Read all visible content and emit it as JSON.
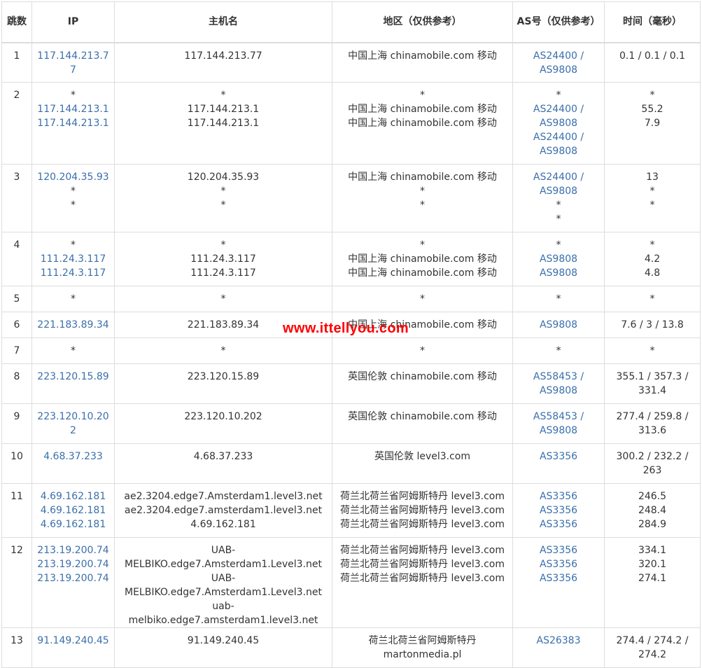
{
  "watermark": "www.ittellyou.com",
  "colors": {
    "link": "#3a6fab",
    "border": "#dddddd",
    "text": "#333333",
    "watermark": "#ff0000"
  },
  "headers": {
    "hop": "跳数",
    "ip": "IP",
    "host": "主机名",
    "region": "地区（仅供参考）",
    "as": "AS号（仅供参考）",
    "time": "时间（毫秒）"
  },
  "rows": [
    {
      "hop": "1",
      "ip": [
        "117.144.213.77"
      ],
      "host": [
        "117.144.213.77"
      ],
      "region": [
        "中国上海 chinamobile.com 移动"
      ],
      "as": [
        "AS24400 /",
        "AS9808"
      ],
      "time": [
        "0.1 / 0.1 / 0.1"
      ]
    },
    {
      "hop": "2",
      "ip": [
        "*",
        "117.144.213.1",
        "117.144.213.1"
      ],
      "host": [
        "*",
        "117.144.213.1",
        "117.144.213.1"
      ],
      "region": [
        "*",
        "中国上海 chinamobile.com 移动",
        "中国上海 chinamobile.com 移动"
      ],
      "as": [
        "*",
        "AS24400 /",
        "AS9808",
        "AS24400 /",
        "AS9808"
      ],
      "time": [
        "*",
        "55.2",
        "7.9"
      ]
    },
    {
      "hop": "3",
      "ip": [
        "120.204.35.93",
        "*",
        "*"
      ],
      "host": [
        "120.204.35.93",
        "*",
        "*"
      ],
      "region": [
        "中国上海 chinamobile.com 移动",
        "*",
        "*"
      ],
      "as": [
        "AS24400 /",
        "AS9808",
        "*",
        "*"
      ],
      "time": [
        "13",
        "*",
        "*"
      ]
    },
    {
      "hop": "4",
      "ip": [
        "*",
        "111.24.3.117",
        "111.24.3.117"
      ],
      "host": [
        "*",
        "111.24.3.117",
        "111.24.3.117"
      ],
      "region": [
        "*",
        "中国上海 chinamobile.com 移动",
        "中国上海 chinamobile.com 移动"
      ],
      "as": [
        "*",
        "AS9808",
        "AS9808"
      ],
      "time": [
        "*",
        "4.2",
        "4.8"
      ]
    },
    {
      "hop": "5",
      "ip": [
        "*"
      ],
      "host": [
        "*"
      ],
      "region": [
        "*"
      ],
      "as": [
        "*"
      ],
      "time": [
        "*"
      ]
    },
    {
      "hop": "6",
      "ip": [
        "221.183.89.34"
      ],
      "host": [
        "221.183.89.34"
      ],
      "region": [
        "中国上海 chinamobile.com 移动"
      ],
      "as": [
        "AS9808"
      ],
      "time": [
        "7.6 / 3 / 13.8"
      ]
    },
    {
      "hop": "7",
      "ip": [
        "*"
      ],
      "host": [
        "*"
      ],
      "region": [
        "*"
      ],
      "as": [
        "*"
      ],
      "time": [
        "*"
      ]
    },
    {
      "hop": "8",
      "ip": [
        "223.120.15.89"
      ],
      "host": [
        "223.120.15.89"
      ],
      "region": [
        "英国伦敦 chinamobile.com 移动"
      ],
      "as": [
        "AS58453 /",
        "AS9808"
      ],
      "time": [
        "355.1 / 357.3 /",
        "331.4"
      ]
    },
    {
      "hop": "9",
      "ip": [
        "223.120.10.202"
      ],
      "host": [
        "223.120.10.202"
      ],
      "region": [
        "英国伦敦 chinamobile.com 移动"
      ],
      "as": [
        "AS58453 /",
        "AS9808"
      ],
      "time": [
        "277.4 / 259.8 /",
        "313.6"
      ]
    },
    {
      "hop": "10",
      "ip": [
        "4.68.37.233"
      ],
      "host": [
        "4.68.37.233"
      ],
      "region": [
        "英国伦敦 level3.com"
      ],
      "as": [
        "AS3356"
      ],
      "time": [
        "300.2 / 232.2 /",
        "263"
      ]
    },
    {
      "hop": "11",
      "ip": [
        "4.69.162.181",
        "4.69.162.181",
        "4.69.162.181"
      ],
      "host": [
        "ae2.3204.edge7.Amsterdam1.level3.net",
        "ae2.3204.edge7.amsterdam1.level3.net",
        "4.69.162.181"
      ],
      "region": [
        "荷兰北荷兰省阿姆斯特丹 level3.com",
        "荷兰北荷兰省阿姆斯特丹 level3.com",
        "荷兰北荷兰省阿姆斯特丹 level3.com"
      ],
      "as": [
        "AS3356",
        "AS3356",
        "AS3356"
      ],
      "time": [
        "246.5",
        "248.4",
        "284.9"
      ]
    },
    {
      "hop": "12",
      "ip": [
        "213.19.200.74",
        "213.19.200.74",
        "213.19.200.74"
      ],
      "host": [
        "UAB-",
        "MELBIKO.edge7.Amsterdam1.Level3.net",
        "UAB-",
        "MELBIKO.edge7.Amsterdam1.Level3.net",
        "uab-melbiko.edge7.amsterdam1.level3.net"
      ],
      "region": [
        "荷兰北荷兰省阿姆斯特丹 level3.com",
        "荷兰北荷兰省阿姆斯特丹 level3.com",
        "荷兰北荷兰省阿姆斯特丹 level3.com"
      ],
      "as": [
        "AS3356",
        "AS3356",
        "AS3356"
      ],
      "time": [
        "334.1",
        "320.1",
        "274.1"
      ]
    },
    {
      "hop": "13",
      "ip": [
        "91.149.240.45"
      ],
      "host": [
        "91.149.240.45"
      ],
      "region": [
        "荷兰北荷兰省阿姆斯特丹",
        "martonmedia.pl"
      ],
      "as": [
        "AS26383"
      ],
      "time": [
        "274.4 / 274.2 /",
        "274.2"
      ]
    }
  ]
}
